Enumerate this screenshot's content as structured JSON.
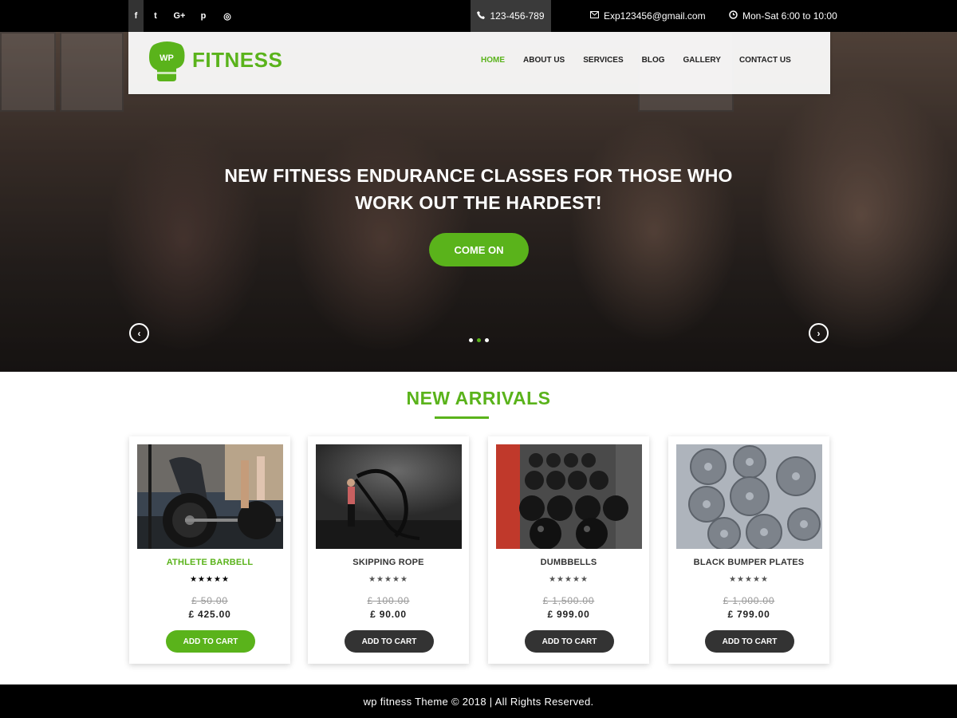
{
  "topbar": {
    "social": [
      {
        "icon": "facebook-icon",
        "glyph": "f"
      },
      {
        "icon": "twitter-icon",
        "glyph": "t"
      },
      {
        "icon": "google-plus-icon",
        "glyph": "G+"
      },
      {
        "icon": "pinterest-icon",
        "glyph": "p"
      },
      {
        "icon": "instagram-icon",
        "glyph": "◎"
      }
    ],
    "phone": "123-456-789",
    "email": "Exp123456@gmail.com",
    "hours": "Mon-Sat 6:00 to 10:00"
  },
  "header": {
    "logo_badge": "WP",
    "logo_text": "FITNESS",
    "nav": [
      "HOME",
      "ABOUT US",
      "SERVICES",
      "BLOG",
      "GALLERY",
      "CONTACT US"
    ],
    "active_nav": "HOME"
  },
  "hero": {
    "title_line1": "NEW FITNESS ENDURANCE  CLASSES FOR THOSE WHO",
    "title_line2": "WORK OUT  THE HARDEST!",
    "button": "COME ON",
    "prev_glyph": "‹",
    "next_glyph": "›",
    "slides": 3,
    "active_slide": 2
  },
  "section": {
    "title": "NEW ARRIVALS"
  },
  "products": [
    {
      "name": "ATHLETE BARBELL",
      "stars": "★★★★★",
      "old_price": "£ 50.00",
      "price": "£ 425.00",
      "button": "ADD TO CART"
    },
    {
      "name": "SKIPPING ROPE",
      "stars": "★★★★★",
      "old_price": "£ 100.00",
      "price": "£ 90.00",
      "button": "ADD TO CART"
    },
    {
      "name": "DUMBBELLS",
      "stars": "★★★★★",
      "old_price": "£ 1,500.00",
      "price": "£ 999.00",
      "button": "ADD TO CART"
    },
    {
      "name": "BLACK BUMPER PLATES",
      "stars": "★★★★★",
      "old_price": "£ 1,000.00",
      "price": "£ 799.00",
      "button": "ADD TO CART"
    }
  ],
  "footer": {
    "text": "wp fitness Theme © 2018 | All Rights Reserved."
  },
  "colors": {
    "accent": "#5ab31b",
    "topbar": "#000000",
    "dark_button": "#333333"
  }
}
